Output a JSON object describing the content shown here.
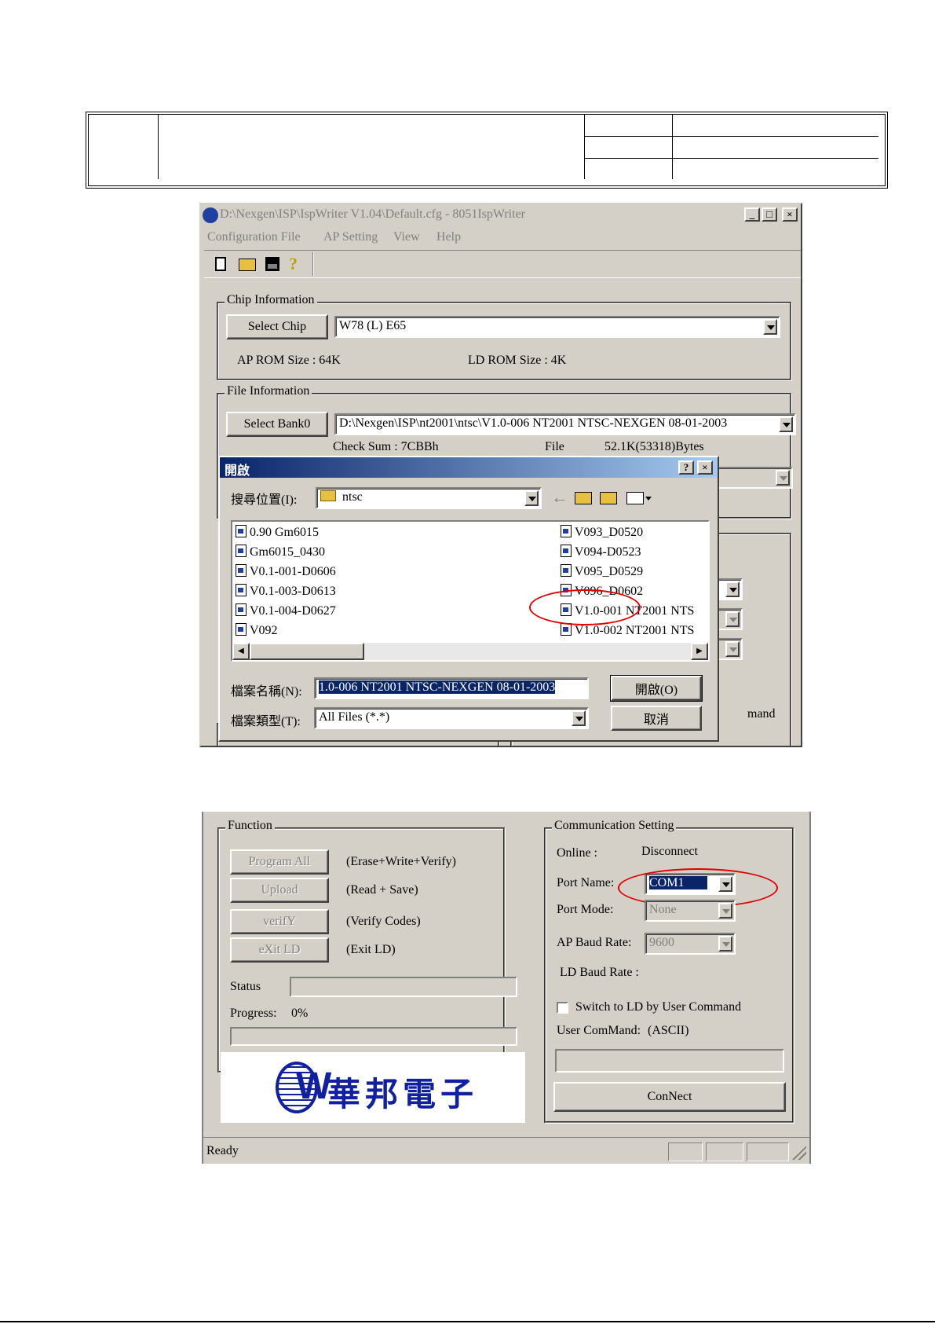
{
  "window": {
    "title": "D:\\Nexgen\\ISP\\IspWriter V1.04\\Default.cfg - 8051IspWriter",
    "menu": [
      "Configuration File",
      "AP Setting",
      "View",
      "Help"
    ]
  },
  "chip": {
    "group_title": "Chip Information",
    "select_button": "Select Chip",
    "chip_value": "W78 (L) E65",
    "ap_rom": "AP ROM Size : 64K",
    "ld_rom": "LD ROM Size : 4K"
  },
  "file": {
    "group_title": "File Information",
    "select_button": "Select Bank0",
    "path_value": "D:\\Nexgen\\ISP\\nt2001\\ntsc\\V1.0-006 NT2001 NTSC-NEXGEN 08-01-2003",
    "checksum": "Check Sum : 7CBBh",
    "file_label": "File",
    "file_size": "52.1K(53318)Bytes"
  },
  "open_dialog": {
    "title": "開啟",
    "look_in_label": "搜尋位置(I):",
    "look_in_value": "ntsc",
    "files_left": [
      "0.90 Gm6015",
      "Gm6015_0430",
      "V0.1-001-D0606",
      "V0.1-003-D0613",
      "V0.1-004-D0627",
      "V092"
    ],
    "files_right": [
      "V093_D0520",
      "V094-D0523",
      "V095_D0529",
      "V096_D0602",
      "V1.0-001 NT2001 NTS",
      "V1.0-002 NT2001 NTS"
    ],
    "filename_label": "檔案名稱(N):",
    "filename_value": "1.0-006 NT2001 NTSC-NEXGEN 08-01-2003",
    "filetype_label": "檔案類型(T):",
    "filetype_value": "All Files (*.*)",
    "open_button": "開啟(O)",
    "cancel_button": "取消",
    "behind_text_1": "mand"
  },
  "function": {
    "group_title": "Function",
    "buttons": [
      {
        "label": "Program All",
        "desc": "(Erase+Write+Verify)"
      },
      {
        "label": "Upload",
        "desc": "(Read + Save)"
      },
      {
        "label": "verifY",
        "desc": "(Verify Codes)"
      },
      {
        "label": "eXit LD",
        "desc": "(Exit LD)"
      }
    ],
    "status_label": "Status",
    "progress_label": "Progress:",
    "progress_value": "0%"
  },
  "comm": {
    "group_title": "Communication Setting",
    "online_label": "Online :",
    "online_value": "Disconnect",
    "port_name_label": "Port Name:",
    "port_name_value": "COM1",
    "port_mode_label": "Port Mode:",
    "port_mode_value": "None",
    "ap_baud_label": "AP Baud Rate:",
    "ap_baud_value": "9600",
    "ld_baud_label": "LD Baud Rate :",
    "switch_label": "Switch to LD by User Command",
    "user_cmd_label": "User ComMand:",
    "user_cmd_hint": "(ASCII)",
    "connect_button": "ConNect"
  },
  "logo": {
    "text": "華邦電子"
  },
  "statusbar": {
    "text": "Ready"
  }
}
